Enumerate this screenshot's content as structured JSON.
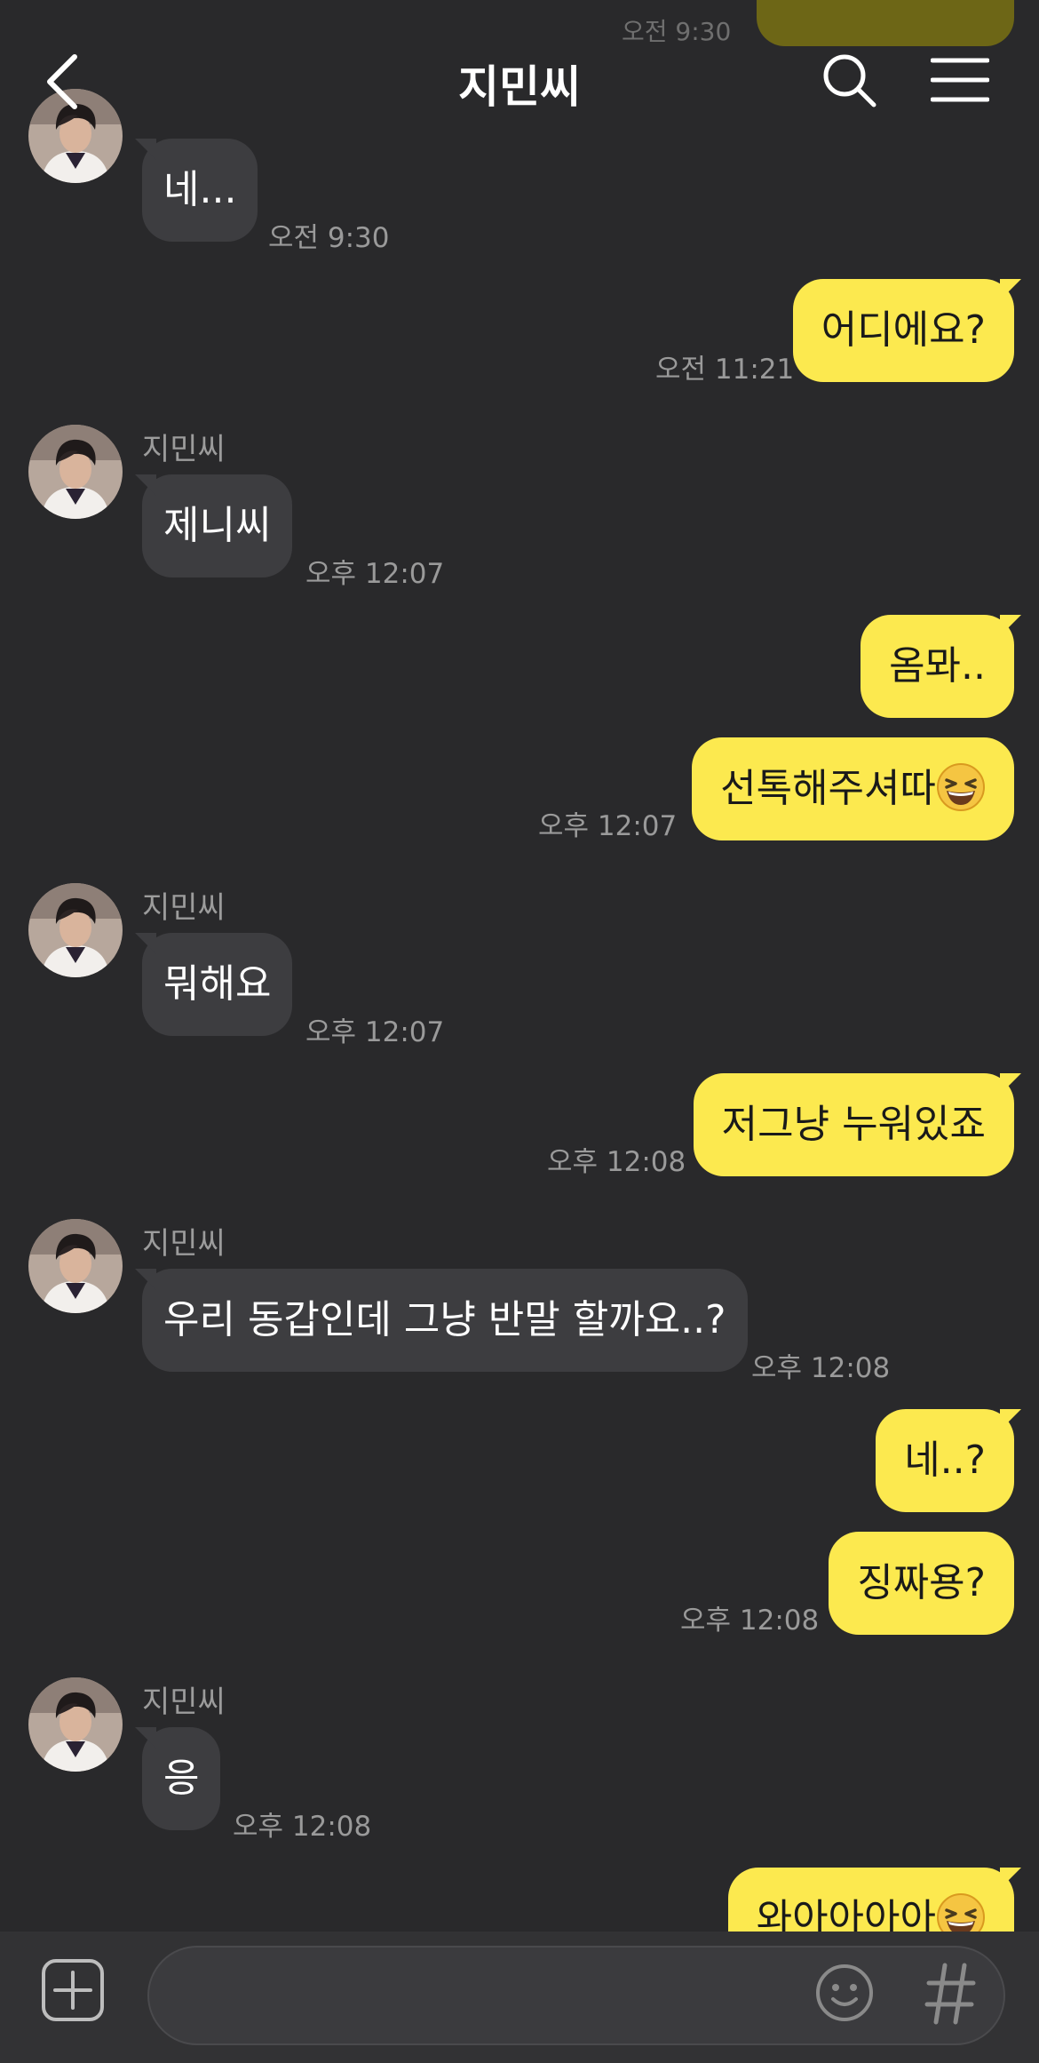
{
  "header": {
    "title": "지민씨",
    "back_icon": "chevron-left-icon",
    "search_icon": "search-icon",
    "menu_icon": "hamburger-menu-icon"
  },
  "contact": {
    "name": "지민씨"
  },
  "messages": [
    {
      "side": "in",
      "sender": "지민씨",
      "text": "네...",
      "time": "오전 9:30"
    },
    {
      "side": "out",
      "text": "어디에요?",
      "time": "오전 11:21"
    },
    {
      "side": "in",
      "sender": "지민씨",
      "text": "제니씨",
      "time": "오후 12:07"
    },
    {
      "side": "out",
      "text": "옴뫄.."
    },
    {
      "side": "out",
      "text": "선톡해주셔따",
      "emoji": "laughing-face",
      "time": "오후 12:07"
    },
    {
      "side": "in",
      "sender": "지민씨",
      "text": "뭐해요",
      "time": "오후 12:07"
    },
    {
      "side": "out",
      "text": "저그냥 누워있죠",
      "time": "오후 12:08"
    },
    {
      "side": "in",
      "sender": "지민씨",
      "text": "우리 동갑인데 그냥 반말 할까요..?",
      "time": "오후 12:08"
    },
    {
      "side": "out",
      "text": "네..?"
    },
    {
      "side": "out",
      "text": "징짜용?",
      "time": "오후 12:08"
    },
    {
      "side": "in",
      "sender": "지민씨",
      "text": "응",
      "time": "오후 12:08"
    },
    {
      "side": "out",
      "text": "와아아아아",
      "emoji": "laughing-face"
    }
  ],
  "input": {
    "placeholder": "",
    "value": ""
  },
  "bottom_bar": {
    "plus_icon": "plus-square-icon",
    "emoji_icon": "smiley-icon",
    "hash_icon": "hashtag-icon"
  },
  "colors": {
    "background": "#29292b",
    "incoming_bubble": "#3d3d40",
    "outgoing_bubble": "#fce94f",
    "timestamp": "#9a9a9a"
  }
}
